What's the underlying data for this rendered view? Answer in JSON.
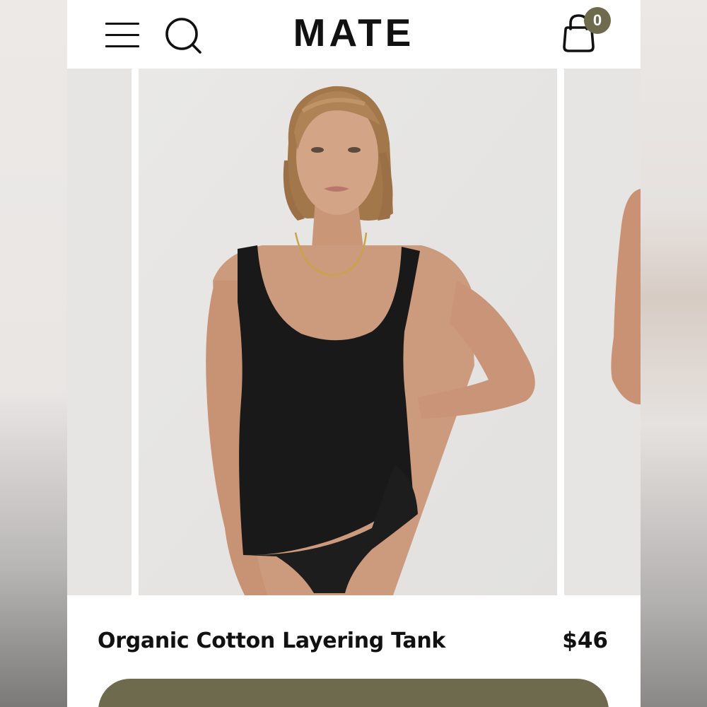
{
  "header": {
    "logo": "MATE",
    "cart_count": "0"
  },
  "icons": {
    "menu": "hamburger-menu-icon",
    "search": "search-icon",
    "cart": "shopping-bag-icon"
  },
  "gallery": {
    "images": [
      "product photo (previous, partially visible)",
      "model wearing black tank top and black briefs",
      "product photo (next, partially visible)"
    ]
  },
  "product": {
    "title": "Organic Cotton Layering Tank",
    "price": "$46"
  },
  "colors": {
    "brand": "#111111",
    "accent": "#6e6a4e",
    "image_bg": "#e6e5e3"
  }
}
